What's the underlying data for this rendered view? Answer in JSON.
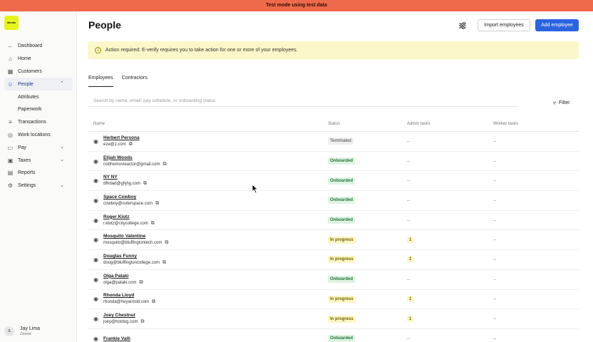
{
  "banner": "Test mode using test data",
  "logo_text": "dbrnds",
  "sidebar": {
    "items": [
      {
        "label": "Dashboard",
        "icon": "arrow-left-icon",
        "type": "top"
      },
      {
        "label": "Home",
        "icon": "home-icon",
        "type": "top"
      },
      {
        "label": "Customers",
        "icon": "building-icon",
        "type": "top"
      },
      {
        "label": "People",
        "icon": "people-icon",
        "type": "active",
        "chevron": "up"
      },
      {
        "label": "Attributes",
        "type": "sub"
      },
      {
        "label": "Paperwork",
        "type": "sub"
      },
      {
        "label": "Transactions",
        "icon": "transactions-icon",
        "type": "top"
      },
      {
        "label": "Work locations",
        "icon": "location-pin-icon",
        "type": "top"
      },
      {
        "label": "Pay",
        "icon": "wallet-icon",
        "type": "top",
        "chevron": "down"
      },
      {
        "label": "Taxes",
        "icon": "tax-icon",
        "type": "top",
        "chevron": "down"
      },
      {
        "label": "Reports",
        "icon": "report-icon",
        "type": "top"
      },
      {
        "label": "Settings",
        "icon": "gear-icon",
        "type": "top",
        "chevron": "down"
      }
    ],
    "user": {
      "initials": "JL",
      "name": "Jay Lima",
      "org": "Zealot"
    }
  },
  "header": {
    "title": "People",
    "import_label": "Import employees",
    "add_label": "Add employee"
  },
  "alert": {
    "text": "Action required: E-verify requires you to take action for one or more of your employees."
  },
  "tabs": [
    {
      "label": "Employees",
      "active": true
    },
    {
      "label": "Contractors",
      "active": false
    }
  ],
  "search": {
    "placeholder": "Search by name, email, pay schedule, or onboarding status",
    "value": ""
  },
  "filter_label": "Filter",
  "table": {
    "headers": {
      "name": "Name",
      "status": "Status",
      "admin": "Admin tasks",
      "worker": "Worker tasks"
    },
    "rows": [
      {
        "name": "Herbert Persona",
        "email": "eze@z.com",
        "status": "Terminated",
        "status_kind": "terminated",
        "admin": "--",
        "worker": "--"
      },
      {
        "name": "Elijah Woods",
        "email": "notthemovieactor@gmail.com",
        "status": "Onboarded",
        "status_kind": "onboarded",
        "admin": "--",
        "worker": "--"
      },
      {
        "name": "NY NY",
        "email": "dfhdad@ghjhg.com",
        "status": "Onboarded",
        "status_kind": "onboarded",
        "admin": "--",
        "worker": "--"
      },
      {
        "name": "Space Cowboy",
        "email": "cowboy@outerspace.com",
        "status": "Onboarded",
        "status_kind": "onboarded",
        "admin": "--",
        "worker": "--"
      },
      {
        "name": "Roger Klotz",
        "email": "r.klotz@citycollege.com",
        "status": "Onboarded",
        "status_kind": "onboarded",
        "admin": "--",
        "worker": "--"
      },
      {
        "name": "Mosquito Valentine",
        "email": "mosquito@bluffingtontech.com",
        "status": "In progress",
        "status_kind": "progress",
        "admin": "1",
        "worker": "--"
      },
      {
        "name": "Douglas Funny",
        "email": "doug@bluffingtoncollege.com",
        "status": "In progress",
        "status_kind": "progress",
        "admin": "1",
        "worker": "--"
      },
      {
        "name": "Olga Pataki",
        "email": "olga@pataki.com",
        "status": "Onboarded",
        "status_kind": "onboarded",
        "admin": "--",
        "worker": "--"
      },
      {
        "name": "Rhonda Lloyd",
        "email": "rhonda@heyarnold.com",
        "status": "In progress",
        "status_kind": "progress",
        "admin": "1",
        "worker": "--"
      },
      {
        "name": "Joey Chestnut",
        "email": "joey@hotdog.com",
        "status": "In progress",
        "status_kind": "progress",
        "admin": "1",
        "worker": "--"
      },
      {
        "name": "Frankie Valli",
        "email": "",
        "status": "Onboarded",
        "status_kind": "onboarded",
        "admin": "--",
        "worker": "--"
      }
    ]
  }
}
